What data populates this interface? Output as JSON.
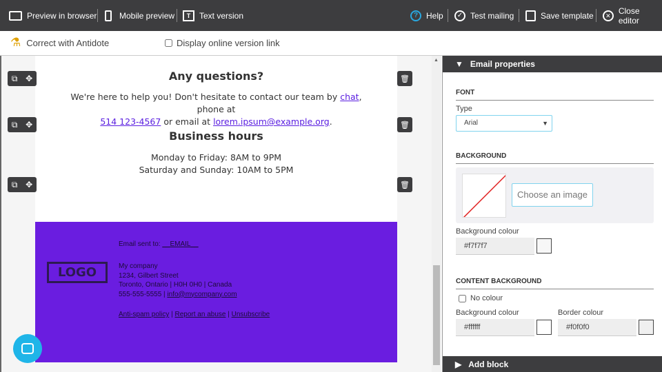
{
  "toolbar": {
    "preview": "Preview in browser",
    "mobile": "Mobile preview",
    "text": "Text version",
    "help": "Help",
    "test": "Test mailing",
    "save": "Save template",
    "close": "Close editor"
  },
  "subbar": {
    "antidote": "Correct with Antidote",
    "online_link": "Display online version link",
    "online_checked": false
  },
  "email": {
    "questions_title": "Any questions?",
    "q_pre": "We're here to help you! Don't hesitate to contact our team by ",
    "chat": "chat",
    "q_mid": ", phone at",
    "phone": "514 123-4567",
    "q_mid2": " or email at ",
    "email": "lorem.ipsum@example.org",
    "q_end": ".",
    "hours_title": "Business hours",
    "hours1": "Monday to Friday: 8AM to 9PM",
    "hours2": "Saturday and Sunday: 10AM to 5PM",
    "footer": {
      "sent_to": "Email sent to: ",
      "sent_email": "__EMAIL__",
      "logo": "LOGO",
      "company": "My company",
      "street": "1234, Gilbert Street",
      "city": "Toronto, Ontario | H0H 0H0 | Canada",
      "phone": "555-555-5555 | ",
      "contact": "info@mycompany.com",
      "antispam": "Anti-spam policy",
      "abuse": "Report an abuse",
      "unsubscribe": "Unsubscribe",
      "sep": " | ",
      "bg_color": "#6a1de0"
    }
  },
  "panel": {
    "title": "Email properties",
    "font_section": "FONT",
    "type_label": "Type",
    "font_value": "Arial",
    "bg_section": "BACKGROUND",
    "choose_image": "Choose an image",
    "bg_colour_label": "Background colour",
    "bg_colour": "#f7f7f7",
    "content_section": "CONTENT BACKGROUND",
    "no_colour": "No colour",
    "content_bg_label": "Background colour",
    "content_bg": "#ffffff",
    "border_label": "Border colour",
    "border_colour": "#f0f0f0",
    "add_block": "Add block"
  }
}
